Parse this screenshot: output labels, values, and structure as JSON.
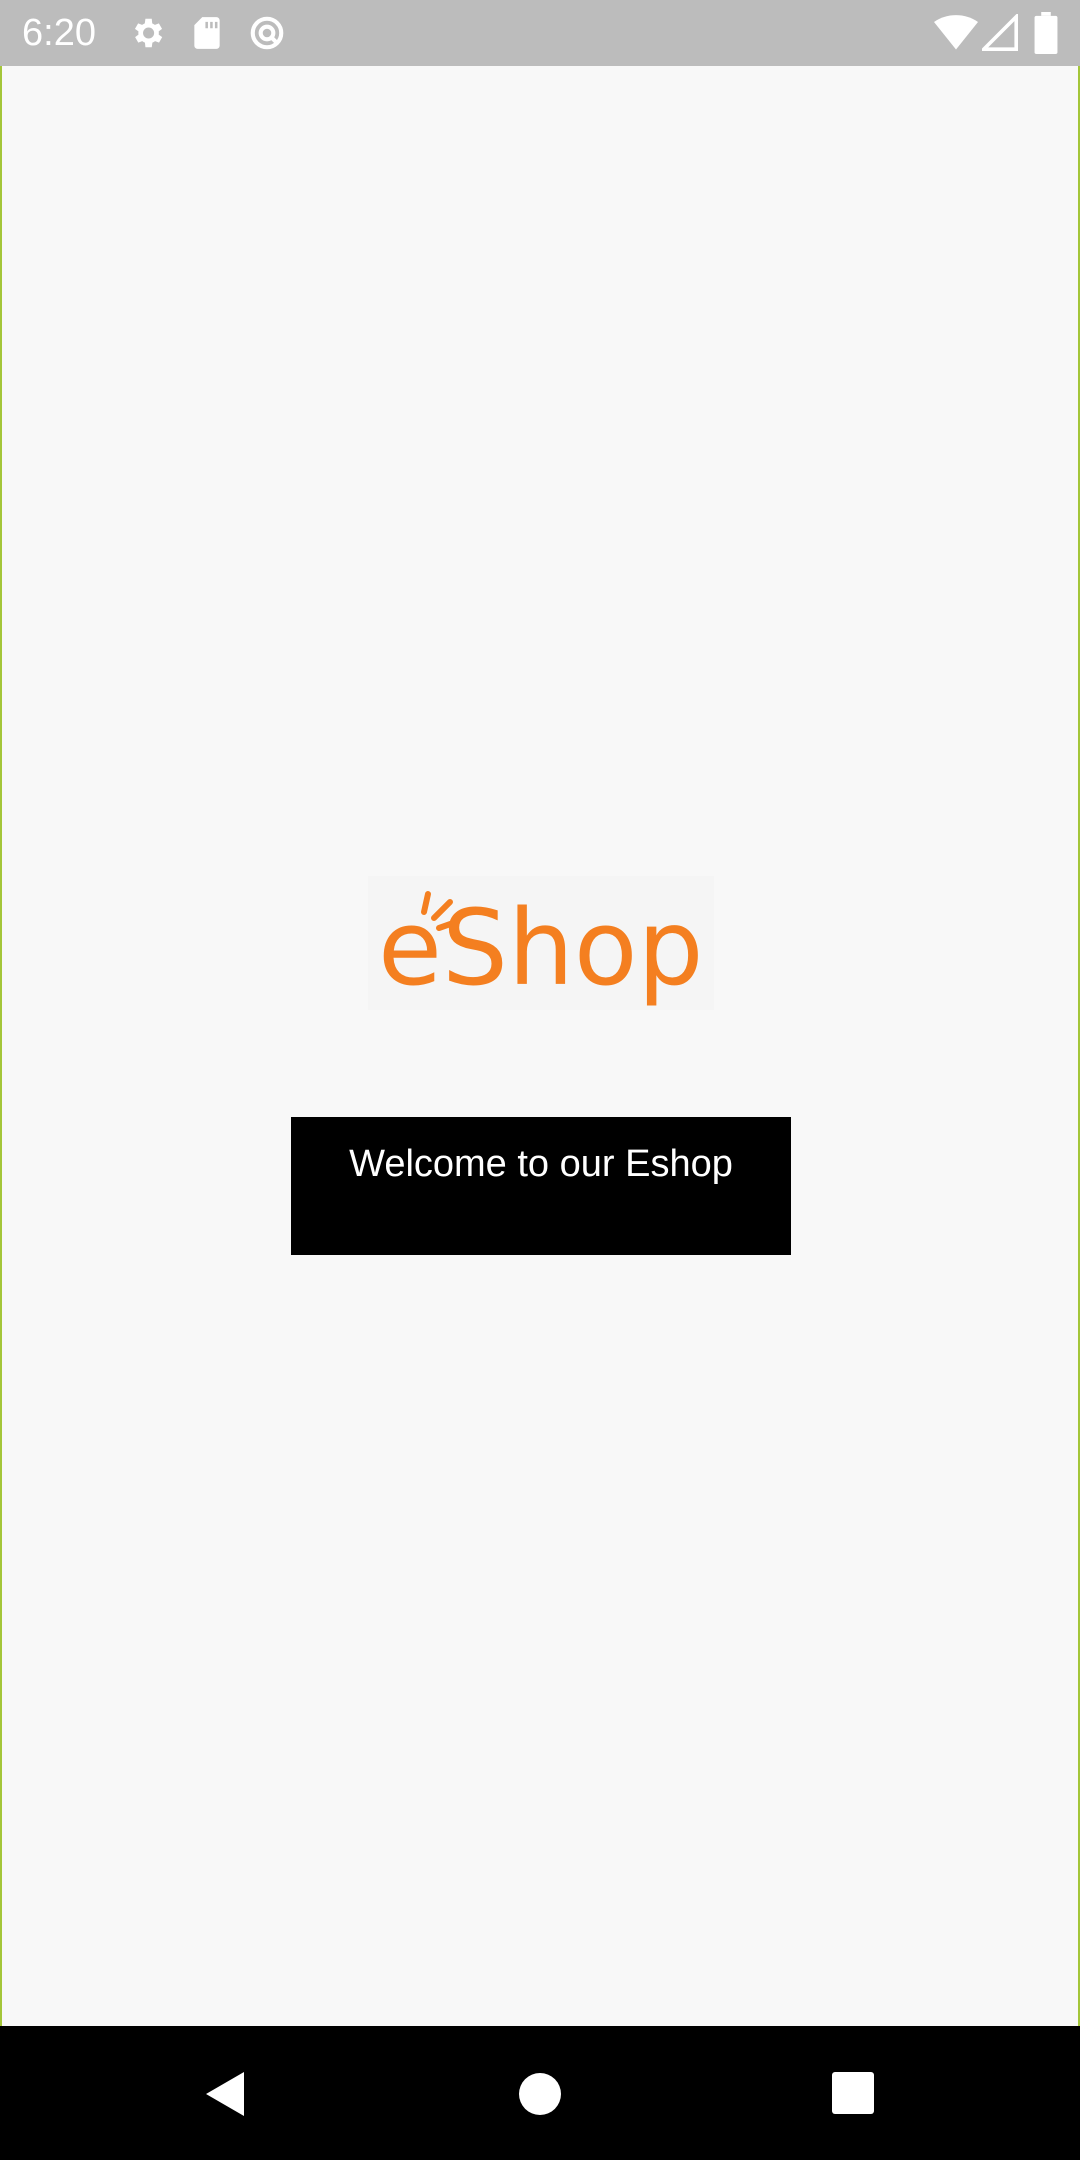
{
  "status_bar": {
    "time": "6:20",
    "left_icons": [
      "settings-icon",
      "sd-card-icon",
      "sync-icon"
    ],
    "right_icons": [
      "wifi-icon",
      "signal-icon",
      "battery-icon"
    ]
  },
  "logo": {
    "text": "eShop",
    "color": "#f47f20"
  },
  "welcome": {
    "text": "Welcome to our Eshop"
  },
  "nav_bar": {
    "buttons": [
      "back-icon",
      "home-icon",
      "recents-icon"
    ]
  },
  "colors": {
    "status_bar": "#bcbcbc",
    "background": "#f8f8f8",
    "frame": "#a4c639",
    "banner": "#000000",
    "nav_bar": "#000000"
  }
}
